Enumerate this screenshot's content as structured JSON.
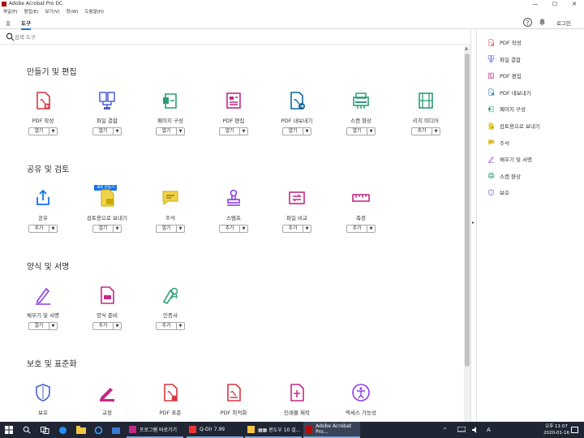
{
  "window": {
    "title": "Adobe Acrobat Pro DC",
    "controls": [
      "—",
      "☐",
      "✕"
    ]
  },
  "menu": [
    "파일(F)",
    "편집(E)",
    "보기(V)",
    "창(W)",
    "도움말(H)"
  ],
  "tabs": {
    "home": "홈",
    "tools": "도구"
  },
  "header": {
    "login": "로그인",
    "help": "?",
    "bell": "🔔"
  },
  "search": {
    "placeholder": "검색 도구"
  },
  "colors": {
    "accent": "#1473e6",
    "red": "#d7373f",
    "purple": "#8d3ce8",
    "green": "#2d9d78",
    "yellow": "#e8c600",
    "magenta": "#c42987",
    "teal": "#0d66a0"
  },
  "sections": [
    {
      "title": "만들기 및 편집",
      "tools": [
        {
          "name": "PDF 작성",
          "btn": "열기",
          "icon": "pdf-create-icon"
        },
        {
          "name": "파일 결합",
          "btn": "열기",
          "icon": "combine-files-icon"
        },
        {
          "name": "페이지 구성",
          "btn": "열기",
          "icon": "organize-pages-icon"
        },
        {
          "name": "PDF 편집",
          "btn": "열기",
          "icon": "edit-pdf-icon"
        },
        {
          "name": "PDF 내보내기",
          "btn": "열기",
          "icon": "export-pdf-icon"
        },
        {
          "name": "스캔 향상",
          "btn": "열기",
          "icon": "enhance-scan-icon"
        },
        {
          "name": "리치 미디어",
          "btn": "추가",
          "icon": "rich-media-icon"
        }
      ]
    },
    {
      "title": "공유 및 검토",
      "tools": [
        {
          "name": "공유",
          "btn": "추가",
          "icon": "share-icon"
        },
        {
          "name": "검토용으로 보내기",
          "btn": "열기",
          "icon": "send-review-icon",
          "badge": "새로 만들기"
        },
        {
          "name": "주석",
          "btn": "열기",
          "icon": "comment-icon"
        },
        {
          "name": "스탬프",
          "btn": "추가",
          "icon": "stamp-icon"
        },
        {
          "name": "파일 비교",
          "btn": "추가",
          "icon": "compare-icon"
        },
        {
          "name": "측정",
          "btn": "추가",
          "icon": "measure-icon"
        }
      ]
    },
    {
      "title": "양식 및 서명",
      "tools": [
        {
          "name": "채우기 및 서명",
          "btn": "열기",
          "icon": "fill-sign-icon"
        },
        {
          "name": "양식 준비",
          "btn": "추가",
          "icon": "prepare-form-icon"
        },
        {
          "name": "인증서",
          "btn": "추가",
          "icon": "certificate-icon"
        }
      ]
    },
    {
      "title": "보호 및 표준화",
      "tools": [
        {
          "name": "보호",
          "btn": "",
          "icon": "protect-icon"
        },
        {
          "name": "교정",
          "btn": "",
          "icon": "redact-icon"
        },
        {
          "name": "PDF 표준",
          "btn": "",
          "icon": "pdf-standards-icon"
        },
        {
          "name": "PDF 최적화",
          "btn": "",
          "icon": "optimize-pdf-icon"
        },
        {
          "name": "인쇄물 제작",
          "btn": "",
          "icon": "print-production-icon"
        },
        {
          "name": "액세스 가능성",
          "btn": "",
          "icon": "accessibility-icon"
        }
      ]
    }
  ],
  "rightpanel": [
    {
      "label": "PDF 작성",
      "icon": "pdf-create-icon"
    },
    {
      "label": "파일 결합",
      "icon": "combine-files-icon"
    },
    {
      "label": "PDF 편집",
      "icon": "edit-pdf-icon"
    },
    {
      "label": "PDF 내보내기",
      "icon": "export-pdf-icon"
    },
    {
      "label": "페이지 구성",
      "icon": "organize-pages-icon"
    },
    {
      "label": "검토용으로 보내기",
      "icon": "send-review-icon"
    },
    {
      "label": "주석",
      "icon": "comment-icon"
    },
    {
      "label": "채우기 및 서명",
      "icon": "fill-sign-icon"
    },
    {
      "label": "스캔 향상",
      "icon": "enhance-scan-icon"
    },
    {
      "label": "보호",
      "icon": "protect-icon"
    }
  ],
  "taskbar": {
    "apps": [
      "프로그램 바로가기",
      "Q-Dir 7.99",
      "▦▦ 윈도우 10 설...",
      "Adobe Acrobat Pro..."
    ],
    "time": "오후 11:07",
    "date": "2020-01-16"
  }
}
